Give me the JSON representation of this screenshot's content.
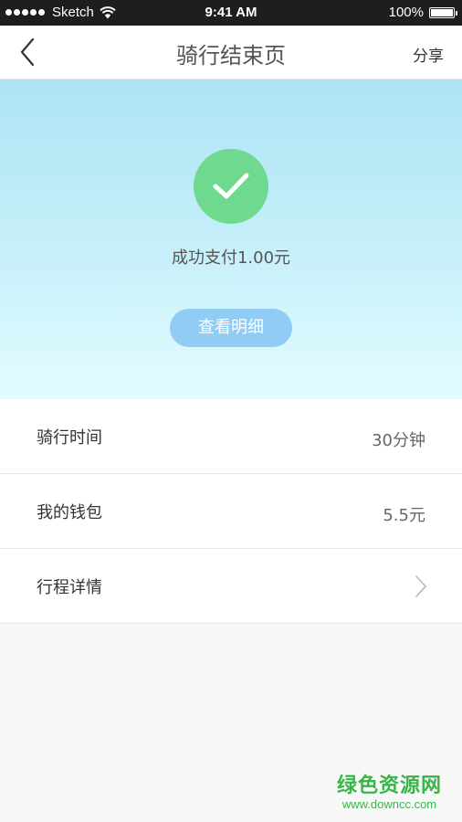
{
  "status_bar": {
    "carrier": "Sketch",
    "time": "9:41 AM",
    "battery": "100%",
    "signal_bars": 5,
    "battery_level": 1.0
  },
  "nav": {
    "title": "骑行结束页",
    "share_label": "分享",
    "back_icon": "chevron-left-icon"
  },
  "result": {
    "icon": "check-icon",
    "message": "成功支付1.00元",
    "detail_button": "查看明细"
  },
  "rows": [
    {
      "label": "骑行时间",
      "value": "30分钟"
    },
    {
      "label": "我的钱包",
      "value": "5.5元"
    },
    {
      "label": "行程详情",
      "icon": "chevron-right-icon"
    }
  ],
  "watermark": {
    "title": "绿色资源网",
    "url": "www.downcc.com"
  },
  "colors": {
    "success": "#6ed98f",
    "button": "#90ccf4",
    "hero_top": "#ace4f4",
    "hero_bottom": "#e2fcff",
    "watermark": "#3ab54a"
  }
}
